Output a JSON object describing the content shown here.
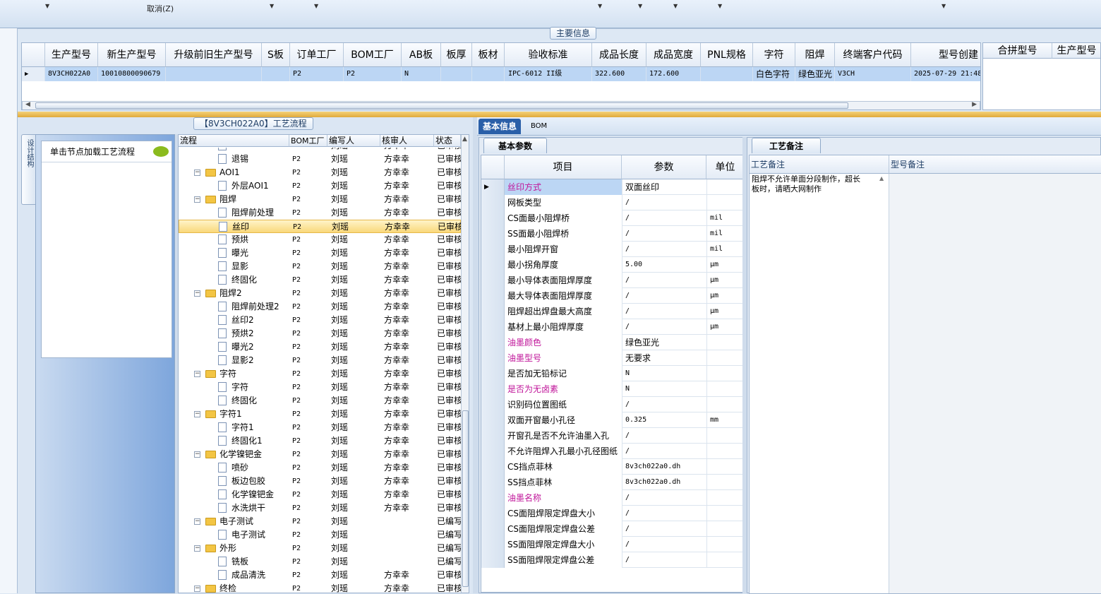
{
  "toolbar": {
    "cancel_label": "取消(Z)"
  },
  "main_info": {
    "section_title": "主要信息",
    "columns": [
      "生产型号",
      "新生产型号",
      "升级前旧生产型号",
      "S板",
      "订单工厂",
      "BOM工厂",
      "AB板",
      "板厚",
      "板材",
      "验收标准",
      "成品长度",
      "成品宽度",
      "PNL规格",
      "字符",
      "阻焊",
      "终端客户代码",
      "型号创建"
    ],
    "row": {
      "c1": "8V3CH022A0",
      "c2": "10010800090679",
      "c3": "",
      "c4": "",
      "c5": "P2",
      "c6": "P2",
      "c7": "N",
      "c8": "",
      "c9": "",
      "c10": "IPC-6012 II级",
      "c11": "322.600",
      "c12": "172.600",
      "c13": "",
      "c14": "白色字符",
      "c15": "绿色亚光",
      "c16": "V3CH",
      "c17": "2025-07-29 21:48"
    },
    "right_columns": [
      "合拼型号",
      "生产型号"
    ]
  },
  "process": {
    "section_title": "【8V3CH022A0】工艺流程",
    "side_tab": "设计结构",
    "hint": "单击节点加载工艺流程",
    "headers": [
      "流程",
      "BOM工厂",
      "编写人",
      "核审人",
      "状态"
    ],
    "rows": [
      {
        "name": "",
        "level": 2,
        "f": "P2",
        "w": "刘瑶",
        "r": "方幸幸",
        "s": "已审核"
      },
      {
        "name": "退锡",
        "level": 2,
        "f": "P2",
        "w": "刘瑶",
        "r": "方幸幸",
        "s": "已审核"
      },
      {
        "name": "AOI1",
        "level": 1,
        "f": "P2",
        "w": "刘瑶",
        "r": "方幸幸",
        "s": "已审核"
      },
      {
        "name": "外层AOI1",
        "level": 2,
        "f": "P2",
        "w": "刘瑶",
        "r": "方幸幸",
        "s": "已审核"
      },
      {
        "name": "阻焊",
        "level": 1,
        "f": "P2",
        "w": "刘瑶",
        "r": "方幸幸",
        "s": "已审核"
      },
      {
        "name": "阻焊前处理",
        "level": 2,
        "f": "P2",
        "w": "刘瑶",
        "r": "方幸幸",
        "s": "已审核"
      },
      {
        "name": "丝印",
        "level": 2,
        "f": "P2",
        "w": "刘瑶",
        "r": "方幸幸",
        "s": "已审核",
        "sel": true
      },
      {
        "name": "预烘",
        "level": 2,
        "f": "P2",
        "w": "刘瑶",
        "r": "方幸幸",
        "s": "已审核"
      },
      {
        "name": "曝光",
        "level": 2,
        "f": "P2",
        "w": "刘瑶",
        "r": "方幸幸",
        "s": "已审核"
      },
      {
        "name": "显影",
        "level": 2,
        "f": "P2",
        "w": "刘瑶",
        "r": "方幸幸",
        "s": "已审核"
      },
      {
        "name": "终固化",
        "level": 2,
        "f": "P2",
        "w": "刘瑶",
        "r": "方幸幸",
        "s": "已审核"
      },
      {
        "name": "阻焊2",
        "level": 1,
        "f": "P2",
        "w": "刘瑶",
        "r": "方幸幸",
        "s": "已审核"
      },
      {
        "name": "阻焊前处理2",
        "level": 2,
        "f": "P2",
        "w": "刘瑶",
        "r": "方幸幸",
        "s": "已审核"
      },
      {
        "name": "丝印2",
        "level": 2,
        "f": "P2",
        "w": "刘瑶",
        "r": "方幸幸",
        "s": "已审核"
      },
      {
        "name": "预烘2",
        "level": 2,
        "f": "P2",
        "w": "刘瑶",
        "r": "方幸幸",
        "s": "已审核"
      },
      {
        "name": "曝光2",
        "level": 2,
        "f": "P2",
        "w": "刘瑶",
        "r": "方幸幸",
        "s": "已审核"
      },
      {
        "name": "显影2",
        "level": 2,
        "f": "P2",
        "w": "刘瑶",
        "r": "方幸幸",
        "s": "已审核"
      },
      {
        "name": "字符",
        "level": 1,
        "f": "P2",
        "w": "刘瑶",
        "r": "方幸幸",
        "s": "已审核"
      },
      {
        "name": "字符",
        "level": 2,
        "f": "P2",
        "w": "刘瑶",
        "r": "方幸幸",
        "s": "已审核"
      },
      {
        "name": "终固化",
        "level": 2,
        "f": "P2",
        "w": "刘瑶",
        "r": "方幸幸",
        "s": "已审核"
      },
      {
        "name": "字符1",
        "level": 1,
        "f": "P2",
        "w": "刘瑶",
        "r": "方幸幸",
        "s": "已审核"
      },
      {
        "name": "字符1",
        "level": 2,
        "f": "P2",
        "w": "刘瑶",
        "r": "方幸幸",
        "s": "已审核"
      },
      {
        "name": "终固化1",
        "level": 2,
        "f": "P2",
        "w": "刘瑶",
        "r": "方幸幸",
        "s": "已审核"
      },
      {
        "name": "化学镍钯金",
        "level": 1,
        "f": "P2",
        "w": "刘瑶",
        "r": "方幸幸",
        "s": "已审核"
      },
      {
        "name": "喷砂",
        "level": 2,
        "f": "P2",
        "w": "刘瑶",
        "r": "方幸幸",
        "s": "已审核"
      },
      {
        "name": "板边包胶",
        "level": 2,
        "f": "P2",
        "w": "刘瑶",
        "r": "方幸幸",
        "s": "已审核"
      },
      {
        "name": "化学镍钯金",
        "level": 2,
        "f": "P2",
        "w": "刘瑶",
        "r": "方幸幸",
        "s": "已审核"
      },
      {
        "name": "水洗烘干",
        "level": 2,
        "f": "P2",
        "w": "刘瑶",
        "r": "方幸幸",
        "s": "已审核"
      },
      {
        "name": "电子测试",
        "level": 1,
        "f": "P2",
        "w": "刘瑶",
        "r": "",
        "s": "已编写"
      },
      {
        "name": "电子测试",
        "level": 2,
        "f": "P2",
        "w": "刘瑶",
        "r": "",
        "s": "已编写"
      },
      {
        "name": "外形",
        "level": 1,
        "f": "P2",
        "w": "刘瑶",
        "r": "",
        "s": "已编写"
      },
      {
        "name": "铣板",
        "level": 2,
        "f": "P2",
        "w": "刘瑶",
        "r": "",
        "s": "已编写"
      },
      {
        "name": "成品清洗",
        "level": 2,
        "f": "P2",
        "w": "刘瑶",
        "r": "方幸幸",
        "s": "已审核"
      },
      {
        "name": "终检",
        "level": 1,
        "f": "P2",
        "w": "刘瑶",
        "r": "方幸幸",
        "s": "已审核"
      }
    ]
  },
  "detail": {
    "tabs": [
      "基本信息",
      "BOM"
    ],
    "subtab": "基本参数",
    "headers": [
      "项目",
      "参数",
      "单位"
    ],
    "rows": [
      {
        "item": "丝印方式",
        "param": "双面丝印",
        "unit": "",
        "hl": true,
        "sel": true
      },
      {
        "item": "网板类型",
        "param": "/",
        "unit": ""
      },
      {
        "item": "CS面最小阻焊桥",
        "param": "/",
        "unit": "mil"
      },
      {
        "item": "SS面最小阻焊桥",
        "param": "/",
        "unit": "mil"
      },
      {
        "item": "最小阻焊开窗",
        "param": "/",
        "unit": "mil"
      },
      {
        "item": "最小拐角厚度",
        "param": "5.00",
        "unit": "μm"
      },
      {
        "item": "最小导体表面阻焊厚度",
        "param": "/",
        "unit": "μm"
      },
      {
        "item": "最大导体表面阻焊厚度",
        "param": "/",
        "unit": "μm"
      },
      {
        "item": "阻焊超出焊盘最大高度",
        "param": "/",
        "unit": "μm"
      },
      {
        "item": "基材上最小阻焊厚度",
        "param": "/",
        "unit": "μm"
      },
      {
        "item": "油墨颜色",
        "param": "绿色亚光",
        "unit": "",
        "hl": true
      },
      {
        "item": "油墨型号",
        "param": "无要求",
        "unit": "",
        "hl": true
      },
      {
        "item": "是否加无铅标记",
        "param": "N",
        "unit": ""
      },
      {
        "item": "是否为无卤素",
        "param": "N",
        "unit": "",
        "hl": true
      },
      {
        "item": "识别码位置图纸",
        "param": "/",
        "unit": ""
      },
      {
        "item": "双面开窗最小孔径",
        "param": "0.325",
        "unit": "mm"
      },
      {
        "item": "开窗孔是否不允许油墨入孔",
        "param": "/",
        "unit": ""
      },
      {
        "item": "不允许阻焊入孔最小孔径图纸",
        "param": "/",
        "unit": ""
      },
      {
        "item": "CS挡点菲林",
        "param": "8v3ch022a0.dh",
        "unit": ""
      },
      {
        "item": "SS挡点菲林",
        "param": "8v3ch022a0.dh",
        "unit": ""
      },
      {
        "item": "油墨名称",
        "param": "/",
        "unit": "",
        "hl": true
      },
      {
        "item": "CS面阻焊限定焊盘大小",
        "param": "/",
        "unit": ""
      },
      {
        "item": "CS面阻焊限定焊盘公差",
        "param": "/",
        "unit": ""
      },
      {
        "item": "SS面阻焊限定焊盘大小",
        "param": "/",
        "unit": ""
      },
      {
        "item": "SS面阻焊限定焊盘公差",
        "param": "/",
        "unit": ""
      }
    ]
  },
  "remarks": {
    "tab": "工艺备注",
    "headers": [
      "工艺备注",
      "型号备注"
    ],
    "text_line1": "阻焊不允许单面分段制作，超长",
    "text_line2": "板时，请晒大网制作"
  },
  "colors": {
    "highlight_text": "#c0169a",
    "selection": "#bcd6f4",
    "accent_tab": "#2a5fa8"
  }
}
